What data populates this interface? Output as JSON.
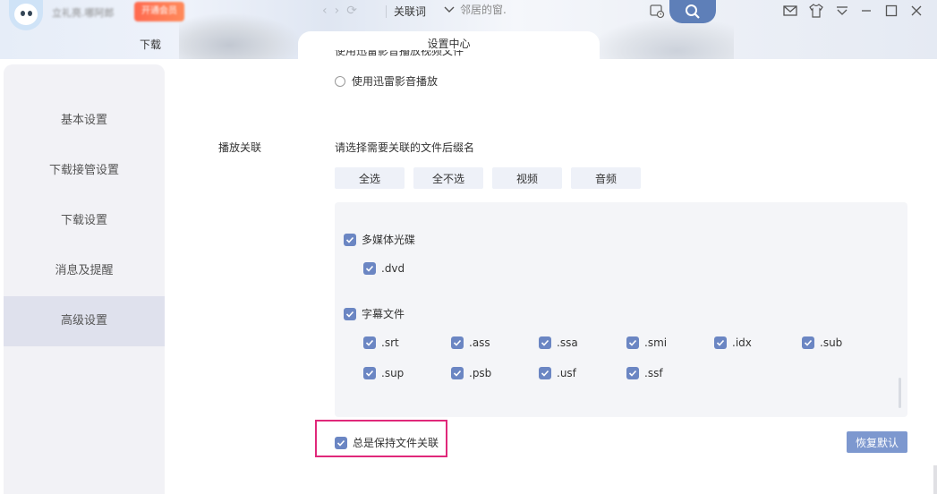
{
  "titlebar": {
    "username": "立礼亮.哪阿郎",
    "vip_badge": "开通会员",
    "search_mode": "关联词",
    "search_placeholder": "邻居的窗.",
    "nav_icons": [
      "back-arrow-icon",
      "forward-arrow-icon",
      "refresh-icon"
    ],
    "window_icons": [
      "mail-icon",
      "skin-shirt-icon",
      "menu-dropdown-icon",
      "minimize-icon",
      "maximize-icon",
      "close-icon"
    ]
  },
  "tabs": {
    "download": "下载",
    "settings": "设置中心"
  },
  "sidebar": {
    "items": [
      {
        "label": "基本设置",
        "active": false
      },
      {
        "label": "下载接管设置",
        "active": false
      },
      {
        "label": "下载设置",
        "active": false
      },
      {
        "label": "消息及提醒",
        "active": false
      },
      {
        "label": "高级设置",
        "active": true
      }
    ]
  },
  "main": {
    "radio_cut": "使用迅雷影音播放视频文件",
    "radio_player": "使用迅雷影音播放",
    "play_assoc_label": "播放关联",
    "hint": "请选择需要关联的文件后缀名",
    "select_buttons": [
      "全选",
      "全不选",
      "视频",
      "音频"
    ],
    "groups": [
      {
        "name": "多媒体光碟",
        "checked": true,
        "items": [
          ".dvd"
        ]
      },
      {
        "name": "字幕文件",
        "checked": true,
        "items": [
          ".srt",
          ".ass",
          ".ssa",
          ".smi",
          ".idx",
          ".sub",
          ".sup",
          ".psb",
          ".usf",
          ".ssf"
        ]
      }
    ],
    "always_keep": "总是保持文件关联",
    "restore_default": "恢复默认"
  },
  "colors": {
    "accent": "#6b86c3",
    "search_button": "#5e7fb8",
    "highlight_border": "#e0287a",
    "sidebar_bg": "#f2f2f6",
    "sidebar_active": "#dfe1ed"
  }
}
